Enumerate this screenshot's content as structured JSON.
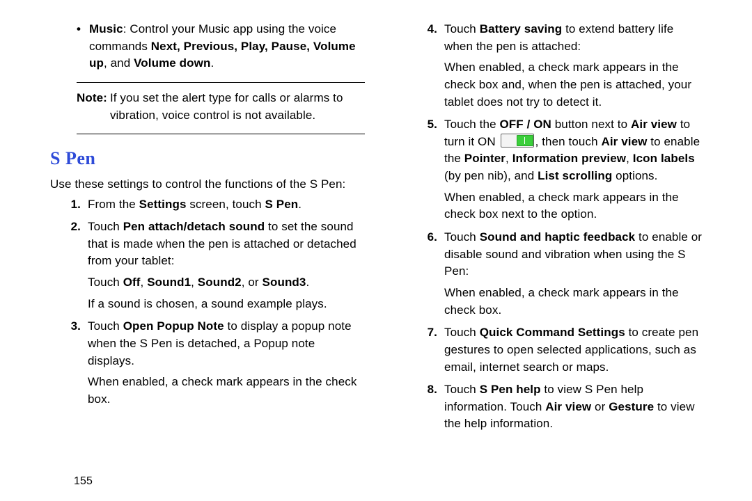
{
  "left": {
    "bullet_label_bold": "Music",
    "bullet_rest": ": Control your Music app using the voice commands ",
    "bullet_cmds": "Next, Previous, Play, Pause, Volume up",
    "bullet_rest2": ", and ",
    "bullet_cmds2": "Volume down",
    "bullet_rest3": ".",
    "note_label": "Note:",
    "note_body": "If you set the alert type for calls or alarms to vibration, voice control is not available.",
    "section": "S Pen",
    "intro": "Use these settings to control the functions of the S Pen:",
    "steps": [
      {
        "num": "1.",
        "paras": [
          {
            "runs": [
              {
                "t": "From the "
              },
              {
                "t": "Settings",
                "b": true
              },
              {
                "t": " screen, touch "
              },
              {
                "t": "S Pen",
                "b": true
              },
              {
                "t": "."
              }
            ]
          }
        ]
      },
      {
        "num": "2.",
        "paras": [
          {
            "runs": [
              {
                "t": "Touch "
              },
              {
                "t": "Pen attach/detach sound",
                "b": true
              },
              {
                "t": " to set the sound that is made when the pen is attached or detached from your tablet:"
              }
            ]
          },
          {
            "runs": [
              {
                "t": "Touch "
              },
              {
                "t": "Off",
                "b": true
              },
              {
                "t": ", "
              },
              {
                "t": "Sound1",
                "b": true
              },
              {
                "t": ", "
              },
              {
                "t": "Sound2",
                "b": true
              },
              {
                "t": ", or "
              },
              {
                "t": "Sound3",
                "b": true
              },
              {
                "t": "."
              }
            ]
          },
          {
            "runs": [
              {
                "t": "If a sound is chosen, a sound example plays."
              }
            ]
          }
        ]
      },
      {
        "num": "3.",
        "paras": [
          {
            "runs": [
              {
                "t": "Touch "
              },
              {
                "t": "Open Popup Note",
                "b": true
              },
              {
                "t": " to display a popup note when the S Pen is detached, a Popup note displays."
              }
            ]
          },
          {
            "runs": [
              {
                "t": "When enabled, a check mark appears in the check box."
              }
            ]
          }
        ]
      }
    ]
  },
  "right": {
    "steps": [
      {
        "num": "4.",
        "paras": [
          {
            "runs": [
              {
                "t": "Touch "
              },
              {
                "t": "Battery saving",
                "b": true
              },
              {
                "t": " to extend battery life when the pen is attached:"
              }
            ]
          },
          {
            "runs": [
              {
                "t": "When enabled, a check mark appears in the check box and, when the pen is attached, your tablet does not try to detect it."
              }
            ]
          }
        ]
      },
      {
        "num": "5.",
        "paras": [
          {
            "runs": [
              {
                "t": "Touch the "
              },
              {
                "t": "OFF / ON",
                "b": true
              },
              {
                "t": " button next to "
              },
              {
                "t": "Air view",
                "b": true
              },
              {
                "t": " to turn it ON "
              },
              {
                "toggle": true
              },
              {
                "t": ", then touch "
              },
              {
                "t": "Air view",
                "b": true
              },
              {
                "t": " to enable the "
              },
              {
                "t": "Pointer",
                "b": true
              },
              {
                "t": ", "
              },
              {
                "t": "Information preview",
                "b": true
              },
              {
                "t": ", "
              },
              {
                "t": "Icon labels",
                "b": true
              },
              {
                "t": " (by pen nib), and "
              },
              {
                "t": "List scrolling",
                "b": true
              },
              {
                "t": " options."
              }
            ]
          },
          {
            "runs": [
              {
                "t": "When enabled, a check mark appears in the check box next to the option."
              }
            ]
          }
        ]
      },
      {
        "num": "6.",
        "paras": [
          {
            "runs": [
              {
                "t": "Touch "
              },
              {
                "t": "Sound and haptic feedback",
                "b": true
              },
              {
                "t": " to enable or disable sound and vibration when using the S Pen:"
              }
            ]
          },
          {
            "runs": [
              {
                "t": "When enabled, a check mark appears in the check box."
              }
            ]
          }
        ]
      },
      {
        "num": "7.",
        "paras": [
          {
            "runs": [
              {
                "t": "Touch "
              },
              {
                "t": "Quick Command Settings",
                "b": true
              },
              {
                "t": " to create pen gestures to open selected applications, such as email, internet search or maps."
              }
            ]
          }
        ]
      },
      {
        "num": "8.",
        "paras": [
          {
            "runs": [
              {
                "t": "Touch "
              },
              {
                "t": "S Pen help",
                "b": true
              },
              {
                "t": " to view S Pen help information. Touch "
              },
              {
                "t": "Air view",
                "b": true
              },
              {
                "t": " or "
              },
              {
                "t": "Gesture",
                "b": true
              },
              {
                "t": " to view the help information."
              }
            ]
          }
        ]
      }
    ]
  },
  "page_number": "155"
}
